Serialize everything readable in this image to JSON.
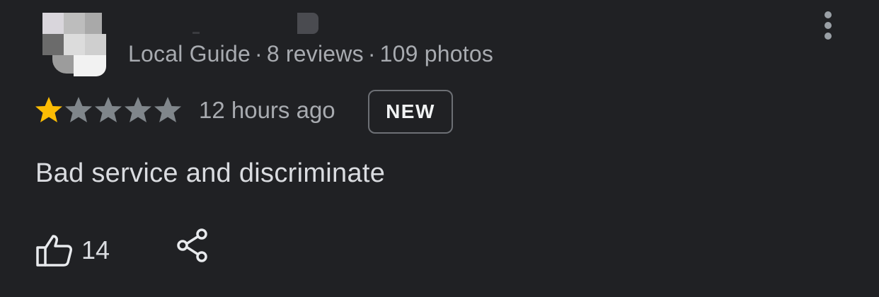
{
  "reviewer": {
    "meta": {
      "badge": "Local Guide",
      "separator": "·",
      "reviews": "8 reviews",
      "photos": "109 photos"
    },
    "avatar_icon": "blurred-avatar",
    "more_icon": "more-vert-icon"
  },
  "rating": {
    "value": 1,
    "max": 5,
    "filled_color": "#fbbc04",
    "empty_color": "#80868b"
  },
  "review": {
    "time": "12 hours ago",
    "badge": "NEW",
    "text": "Bad service and discriminate"
  },
  "actions": {
    "like_icon": "thumbs-up-icon",
    "like_count": "14",
    "share_icon": "share-icon"
  }
}
